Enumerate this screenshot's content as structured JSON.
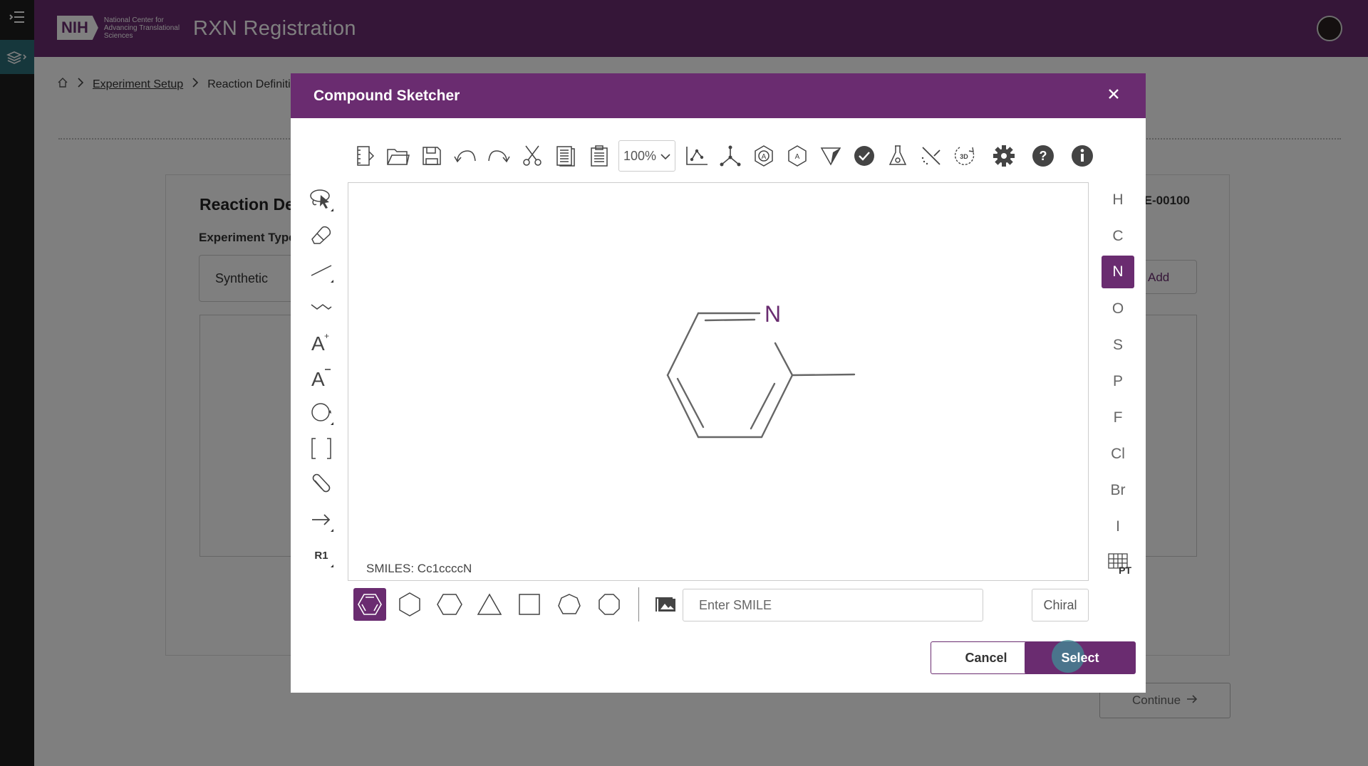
{
  "app": {
    "title": "RXN Registration",
    "logo_text": "NIH",
    "logo_subtitle": "National Center for Advancing Translational Sciences"
  },
  "breadcrumb": {
    "items": [
      "Experiment Setup",
      "Reaction Definiti"
    ]
  },
  "background": {
    "card_title": "Reaction De",
    "experiment_type_label": "Experiment Type",
    "experiment_type_value": "Synthetic",
    "experiment_id": "-E-00100",
    "add_label": "Add",
    "continue_label": "Continue"
  },
  "dialog": {
    "title": "Compound Sketcher",
    "zoom": "100%",
    "smiles_display": "SMILES: Cc1ccccN",
    "molecule_atom_label": "N",
    "smile_placeholder": "Enter SMILE",
    "chiral_label": "Chiral",
    "cancel_label": "Cancel",
    "select_label": "Select",
    "elements": [
      "H",
      "C",
      "N",
      "O",
      "S",
      "P",
      "F",
      "Cl",
      "Br",
      "I"
    ],
    "selected_element": "N",
    "periodic_table_label": "PT",
    "left_tools": [
      "R1"
    ]
  },
  "colors": {
    "brand": "#6a2c70",
    "rail": "#1e1e1e",
    "rail_active": "#2c6e79"
  }
}
